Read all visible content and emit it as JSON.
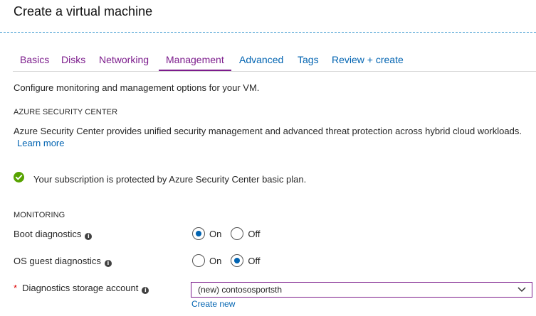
{
  "page": {
    "title": "Create a virtual machine"
  },
  "tabs": [
    {
      "label": "Basics",
      "state": "visited"
    },
    {
      "label": "Disks",
      "state": "visited"
    },
    {
      "label": "Networking",
      "state": "visited"
    },
    {
      "label": "Management",
      "state": "active"
    },
    {
      "label": "Advanced",
      "state": "unvisited"
    },
    {
      "label": "Tags",
      "state": "unvisited"
    },
    {
      "label": "Review + create",
      "state": "unvisited"
    }
  ],
  "intro": "Configure monitoring and management options for your VM.",
  "security": {
    "heading": "AZURE SECURITY CENTER",
    "description": "Azure Security Center provides unified security management and advanced threat protection across hybrid cloud workloads.",
    "learn_more": "Learn more",
    "status": "Your subscription is protected by Azure Security Center basic plan.",
    "status_icon": "check-circle-icon"
  },
  "monitoring": {
    "heading": "MONITORING",
    "boot_diagnostics": {
      "label": "Boot diagnostics",
      "on_label": "On",
      "off_label": "Off",
      "value": "On"
    },
    "os_guest_diagnostics": {
      "label": "OS guest diagnostics",
      "on_label": "On",
      "off_label": "Off",
      "value": "Off"
    },
    "storage_account": {
      "required_mark": "*",
      "label": "Diagnostics storage account",
      "value": "(new) contososportsth",
      "create_new": "Create new"
    }
  },
  "colors": {
    "accent_purple": "#7c1c8c",
    "link_blue": "#0063b1",
    "success_green": "#57a300",
    "required_red": "#d00000"
  },
  "icons": {
    "info": "info-icon",
    "chevron": "chevron-down-icon"
  }
}
